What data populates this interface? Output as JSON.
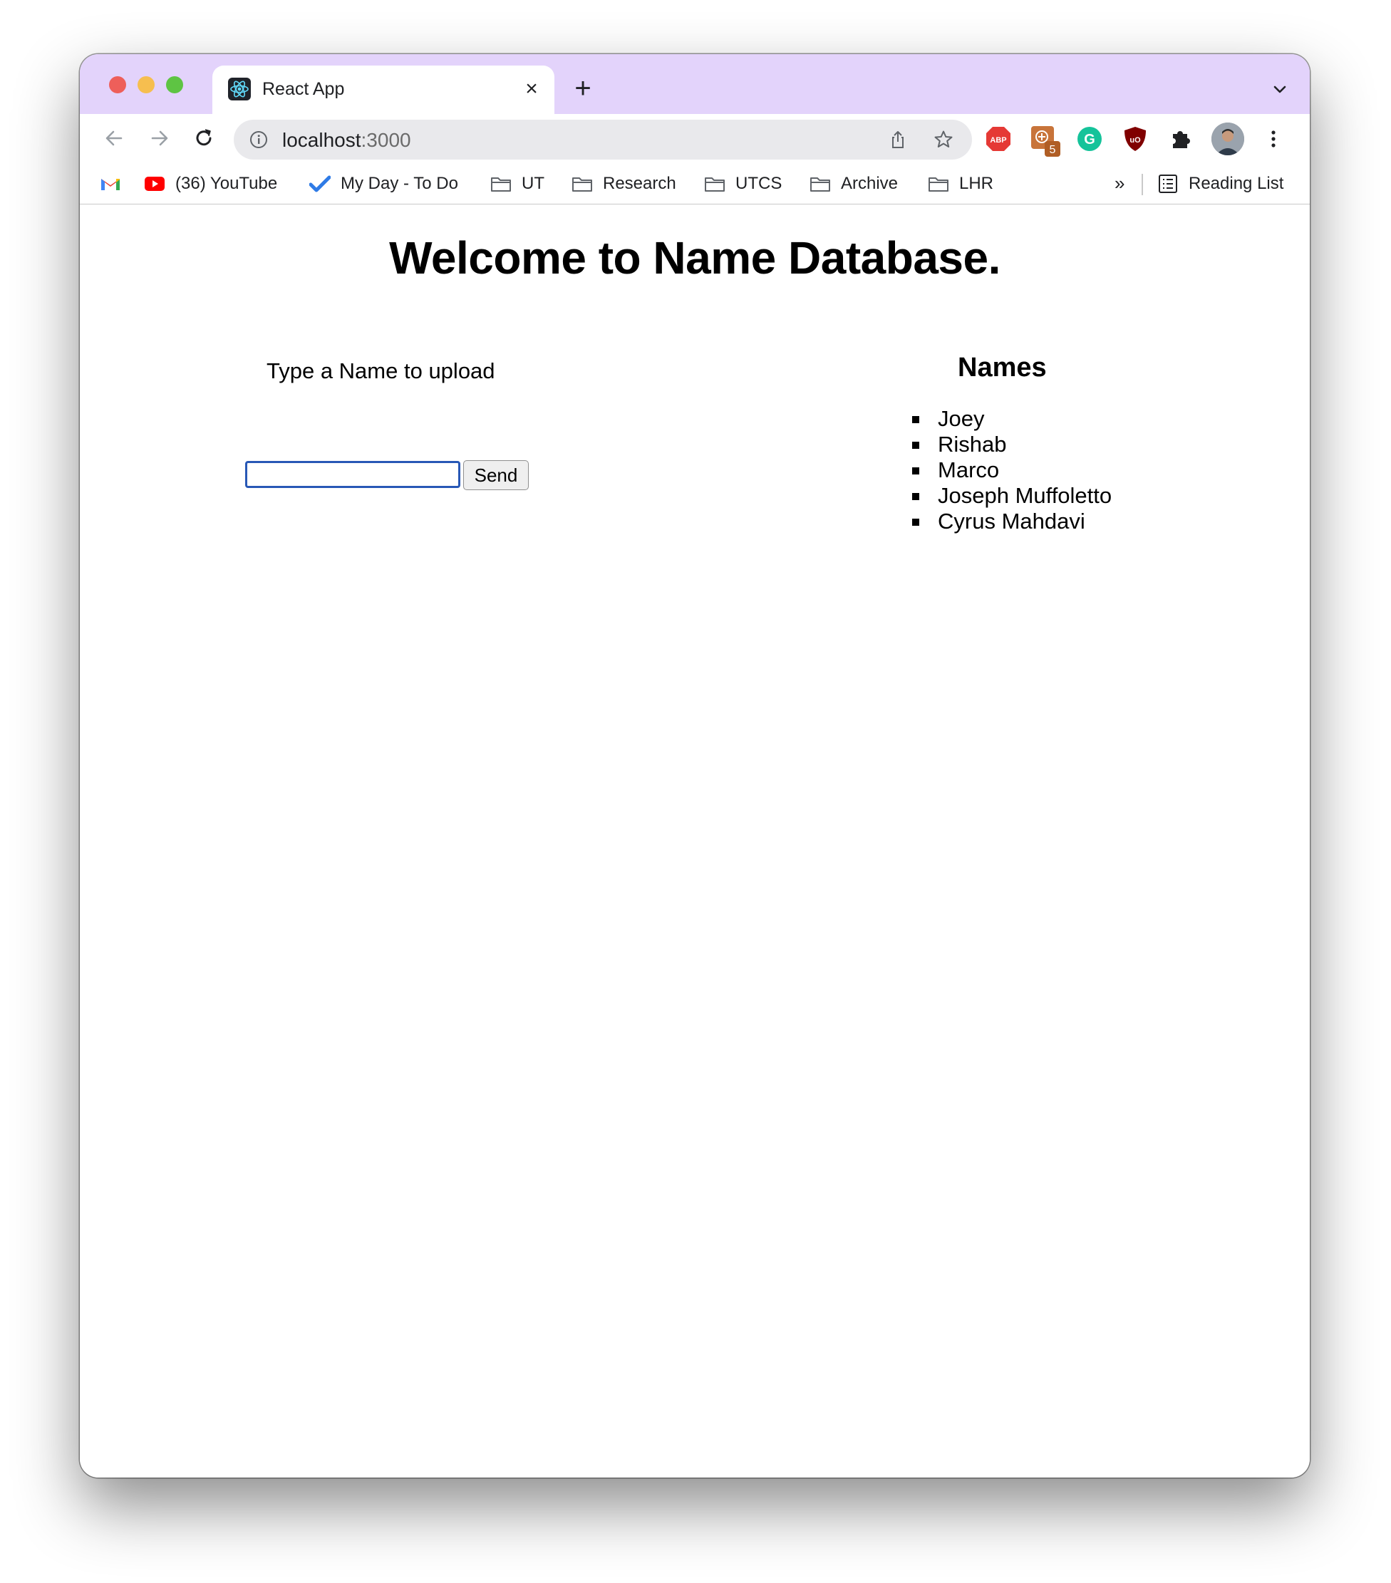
{
  "browser": {
    "tab": {
      "title": "React App",
      "favicon": "react-logo-icon"
    },
    "address_bar": {
      "host": "localhost",
      "port": ":3000"
    },
    "bookmarks": [
      {
        "label": "",
        "icon": "gmail-icon"
      },
      {
        "label": "(36) YouTube",
        "icon": "youtube-icon"
      },
      {
        "label": "My Day - To Do",
        "icon": "todo-check-icon"
      },
      {
        "label": "UT",
        "icon": "folder-icon"
      },
      {
        "label": "Research",
        "icon": "folder-icon"
      },
      {
        "label": "UTCS",
        "icon": "folder-icon"
      },
      {
        "label": "Archive",
        "icon": "folder-icon"
      },
      {
        "label": "LHR",
        "icon": "folder-icon"
      }
    ],
    "bookmarks_overflow": "»",
    "reading_list": "Reading List",
    "extensions": [
      {
        "name": "adblock-plus-icon",
        "text": "ABP",
        "color": "#e53935"
      },
      {
        "name": "extension-badge-icon",
        "badge": "5",
        "color": "#c8743a"
      },
      {
        "name": "grammarly-icon",
        "text": "G",
        "color": "#15c39a"
      },
      {
        "name": "ublock-icon",
        "text": "uO",
        "color": "#800000"
      }
    ]
  },
  "page": {
    "title": "Welcome to Name Database.",
    "upload": {
      "label": "Type a Name to upload",
      "input_value": "",
      "button": "Send"
    },
    "names": {
      "heading": "Names",
      "items": [
        "Joey",
        "Rishab",
        "Marco",
        "Joseph Muffoletto",
        "Cyrus Mahdavi"
      ]
    }
  },
  "colors": {
    "tabstrip": "#e3d3fb",
    "input_focus": "#2858b6"
  }
}
